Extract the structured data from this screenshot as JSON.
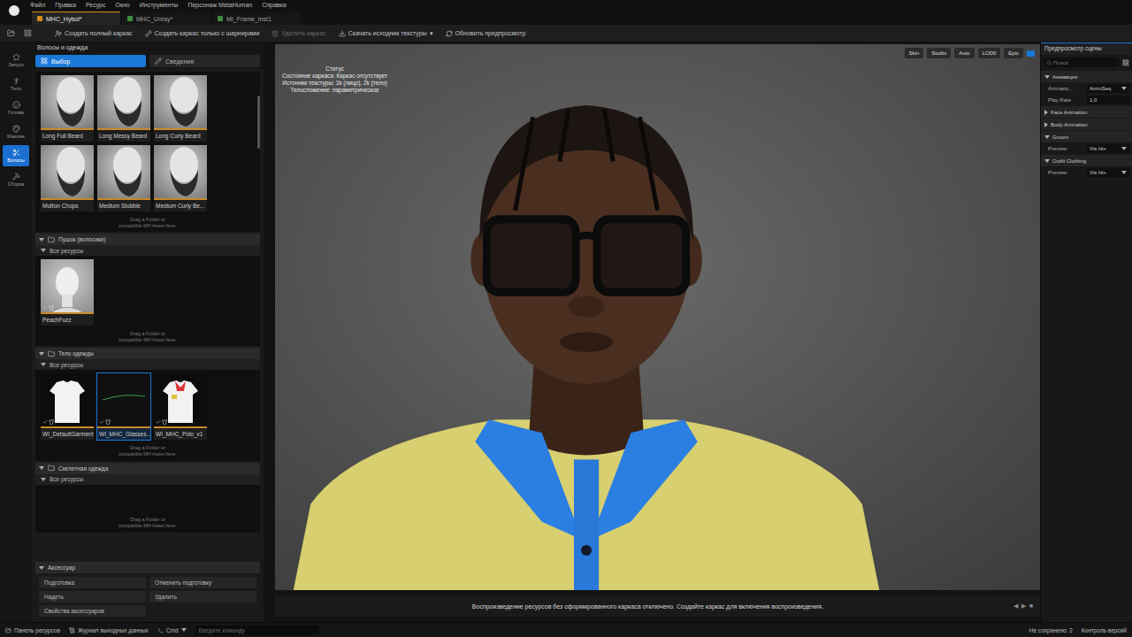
{
  "menu": [
    "Файл",
    "Правка",
    "Ресурс",
    "Окно",
    "Инструменты",
    "Персонаж MetaHuman",
    "Справка"
  ],
  "doc_tabs": [
    {
      "label": "MHC_Hybol*",
      "selected": true
    },
    {
      "label": "MHC_Unray*",
      "selected": false
    },
    {
      "label": "MI_Frame_Inst1",
      "selected": false
    }
  ],
  "toolbar": [
    {
      "label": "Создать полный каркас",
      "disabled": false,
      "caret": ""
    },
    {
      "label": "Создать каркас только с шарнирами",
      "disabled": false,
      "caret": ""
    },
    {
      "label": "Удалить каркас",
      "disabled": true,
      "caret": ""
    },
    {
      "label": "Скачать исходник текстуры",
      "disabled": false,
      "caret": "▾"
    },
    {
      "label": "Обновить предпросмотр",
      "disabled": false,
      "caret": ""
    }
  ],
  "rail": [
    {
      "label": "Запуск",
      "selected": false
    },
    {
      "label": "Тело",
      "selected": false
    },
    {
      "label": "Голова",
      "selected": false
    },
    {
      "label": "Макияж",
      "selected": false
    },
    {
      "label": "Волосы",
      "selected": true
    },
    {
      "label": "Сборка",
      "selected": false
    }
  ],
  "left_panel": {
    "title": "Волосы и одежда",
    "tabs": [
      {
        "label": "Выбор",
        "selected": true
      },
      {
        "label": "Сведения",
        "selected": false
      }
    ],
    "sections": [
      {
        "title": "",
        "subtitle": "",
        "expanded": true,
        "hint": [
          "Drag a Folder or",
          "compatible MH Asset here."
        ],
        "items": [
          {
            "label": "Long Full Beard",
            "kind": "beard",
            "selected": false,
            "badge": false
          },
          {
            "label": "Long Messy Beard",
            "kind": "beard",
            "selected": false,
            "badge": false
          },
          {
            "label": "Long Curly Beard",
            "kind": "beard",
            "selected": false,
            "badge": false
          },
          {
            "label": "Mutton Chops",
            "kind": "beard",
            "selected": false,
            "badge": false
          },
          {
            "label": "Medium Stubble",
            "kind": "beard",
            "selected": false,
            "badge": false
          },
          {
            "label": "Medium Curly Be...",
            "kind": "beard",
            "selected": false,
            "badge": false
          }
        ]
      },
      {
        "title": "Пушок (волосики)",
        "subtitle": "Все ресурсы",
        "expanded": true,
        "hint": [
          "Drag a Folder or",
          "compatible MH Asset here."
        ],
        "items": [
          {
            "label": "PeachFuzz",
            "kind": "head",
            "selected": false,
            "badge": true
          }
        ]
      },
      {
        "title": "Тело одежды",
        "subtitle": "Все ресурсы",
        "expanded": true,
        "hint": [
          "Drag a Folder or",
          "compatible MH Asset here."
        ],
        "items": [
          {
            "label": "WI_DefaultGarment",
            "kind": "garment",
            "selected": false,
            "badge": true
          },
          {
            "label": "WI_MHC_Glasses...",
            "kind": "glasses",
            "selected": true,
            "badge": true
          },
          {
            "label": "WI_MHC_Polo_v1",
            "kind": "polo",
            "selected": false,
            "badge": true
          }
        ]
      },
      {
        "title": "Скелетная одежда",
        "subtitle": "Все ресурсы",
        "expanded": true,
        "hint": [
          "Drag a Folder or",
          "compatible MH Asset here."
        ],
        "items": []
      }
    ],
    "accessory": {
      "title": "Аксессуар",
      "buttons": [
        "Подготовка",
        "Отменить подготовку",
        "Надеть",
        "Удалить",
        "Свойства аксессуаров"
      ]
    }
  },
  "viewport": {
    "pills": [
      "Skin",
      "Studio",
      "Auto",
      "LOD0",
      "Epic"
    ],
    "status": {
      "title": "Статус",
      "lines": [
        "Состояние каркаса: Каркас отсутствует",
        "Источник текстуры: 1k (лицо), 2k (тело)",
        "Телосложение: параметрическое"
      ]
    },
    "message": "Воспроизведение ресурсов без сформированного каркаса отключено. Создайте каркас для включения воспроизведения.",
    "nav": [
      "◀",
      "▶",
      "■"
    ]
  },
  "right_panel": {
    "title": "Предпросмотр сцены",
    "search": "Поиск",
    "sections": [
      {
        "title": "Анимация",
        "expanded": true,
        "rows": [
          {
            "label": "Animatio...",
            "value": "AnimSeq",
            "kind": "dropdown"
          },
          {
            "label": "Play Rate",
            "value": "1.0",
            "kind": "number"
          }
        ]
      },
      {
        "title": "Face Animation",
        "expanded": false,
        "rows": []
      },
      {
        "title": "Body Animation",
        "expanded": false,
        "rows": []
      },
      {
        "title": "Groom",
        "expanded": true,
        "rows": [
          {
            "label": "Preview",
            "value": "Vis Hi+",
            "kind": "dropdown"
          }
        ]
      },
      {
        "title": "Outfit Clothing",
        "expanded": true,
        "rows": [
          {
            "label": "Preview",
            "value": "Vis Hi+",
            "kind": "dropdown"
          }
        ]
      }
    ]
  },
  "status_bar": {
    "left": [
      "Панель ресурсов",
      "Журнал выходных данных"
    ],
    "cmd": "Cmd",
    "cmd_placeholder": "Введите команду",
    "right": [
      "Не сохранено: 2",
      "Контроль версий"
    ]
  }
}
